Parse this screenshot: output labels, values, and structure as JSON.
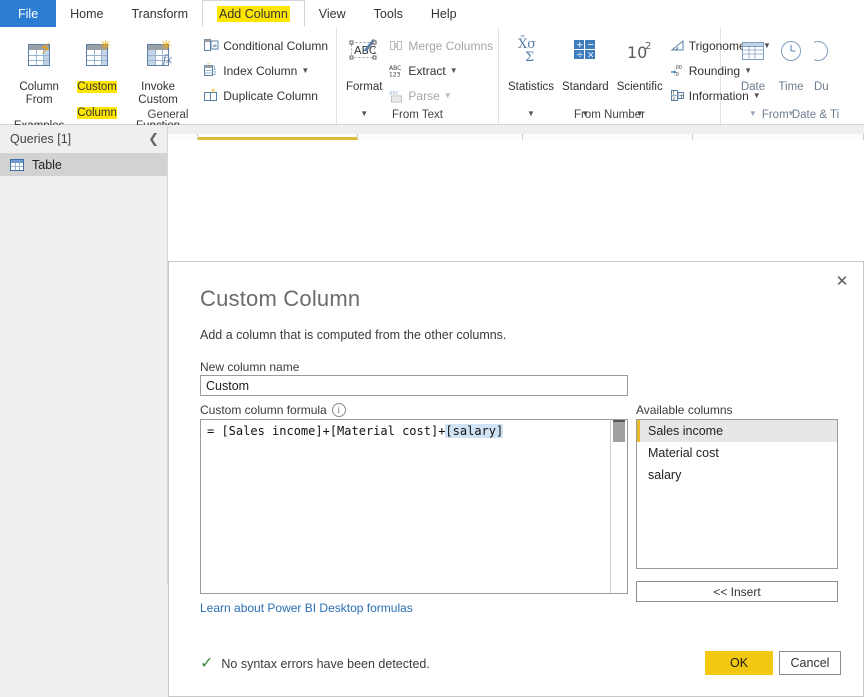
{
  "ribbon": {
    "tabs": [
      {
        "label": "File",
        "state": "file"
      },
      {
        "label": "Home",
        "state": "normal"
      },
      {
        "label": "Transform",
        "state": "normal"
      },
      {
        "label": "Add Column",
        "state": "active-highlighted"
      },
      {
        "label": "View",
        "state": "normal"
      },
      {
        "label": "Tools",
        "state": "normal"
      },
      {
        "label": "Help",
        "state": "normal"
      }
    ],
    "groups": [
      {
        "label": "General",
        "big_buttons": [
          {
            "line1": "Column From",
            "line2": "Examples",
            "has_caret": true,
            "icon": "table-bolt-icon",
            "highlighted": false
          },
          {
            "line1": "Custom",
            "line2": "Column",
            "has_caret": false,
            "icon": "table-star-icon",
            "highlighted": true
          },
          {
            "line1": "Invoke Custom",
            "line2": "Function",
            "has_caret": false,
            "icon": "table-fx-icon",
            "highlighted": false
          }
        ],
        "small_buttons": [
          {
            "label": "Conditional Column",
            "icon": "conditional-column-icon",
            "caret": false,
            "disabled": false
          },
          {
            "label": "Index Column",
            "icon": "index-column-icon",
            "caret": true,
            "disabled": false
          },
          {
            "label": "Duplicate Column",
            "icon": "duplicate-column-icon",
            "caret": false,
            "disabled": false
          }
        ]
      },
      {
        "label": "From Text",
        "big_buttons": [
          {
            "line1": "Format",
            "line2": "",
            "has_caret": true,
            "icon": "abc-format-icon",
            "highlighted": false
          }
        ],
        "small_buttons": [
          {
            "label": "Merge Columns",
            "icon": "merge-columns-icon",
            "caret": false,
            "disabled": true
          },
          {
            "label": "Extract",
            "icon": "abc123-extract-icon",
            "caret": true,
            "disabled": false
          },
          {
            "label": "Parse",
            "icon": "abc-parse-icon",
            "caret": true,
            "disabled": true
          }
        ]
      },
      {
        "label": "From Number",
        "big_buttons": [
          {
            "line1": "Statistics",
            "line2": "",
            "has_caret": true,
            "icon": "sigma-statistics-icon",
            "highlighted": false
          },
          {
            "line1": "Standard",
            "line2": "",
            "has_caret": true,
            "icon": "standard-math-icon",
            "highlighted": false
          },
          {
            "line1": "Scientific",
            "line2": "",
            "has_caret": true,
            "icon": "scientific-icon",
            "highlighted": false
          }
        ],
        "small_buttons": [
          {
            "label": "Trigonometry",
            "icon": "trigonometry-icon",
            "caret": true,
            "disabled": false
          },
          {
            "label": "Rounding",
            "icon": "rounding-icon",
            "caret": true,
            "disabled": false
          },
          {
            "label": "Information",
            "icon": "information-icon",
            "caret": true,
            "disabled": false
          }
        ]
      },
      {
        "label": "From Date & Ti",
        "big_buttons": [
          {
            "line1": "Date",
            "line2": "",
            "has_caret": true,
            "icon": "calendar-icon",
            "highlighted": false
          },
          {
            "line1": "Time",
            "line2": "",
            "has_caret": true,
            "icon": "clock-icon",
            "highlighted": false
          },
          {
            "line1": "Du",
            "line2": "",
            "has_caret": false,
            "icon": "duration-icon",
            "highlighted": false
          }
        ],
        "small_buttons": []
      }
    ]
  },
  "queries": {
    "title": "Queries [1]",
    "collapse_icon": "chevron-left-icon",
    "items": [
      {
        "label": "Table",
        "icon": "table-icon",
        "selected": true
      }
    ]
  },
  "dialog": {
    "title": "Custom Column",
    "subtitle": "Add a column that is computed from the other columns.",
    "close_label": "✕",
    "new_column_name_label": "New column name",
    "new_column_name_value": "Custom",
    "formula_label": "Custom column formula",
    "formula_info_icon": "info-icon",
    "formula_prefix": "= [Sales income]+[Material cost]+",
    "formula_selected": "[salary]",
    "learn_link": "Learn about Power BI Desktop formulas",
    "status_icon": "checkmark-icon",
    "status_text": "No syntax errors have been detected.",
    "available_columns_label": "Available columns",
    "available_columns": [
      {
        "label": "Sales income",
        "selected": true
      },
      {
        "label": "Material cost",
        "selected": false
      },
      {
        "label": "salary",
        "selected": false
      }
    ],
    "insert_label": "<< Insert",
    "ok_label": "OK",
    "cancel_label": "Cancel"
  },
  "colors": {
    "file_tab_blue": "#2b7cd3",
    "highlight_yellow": "#ffe600",
    "ok_button_yellow": "#f2c811",
    "selected_column_accent": "#e8b929",
    "link_blue": "#2a6fb5",
    "success_green": "#3c8a3c",
    "formula_selection_blue": "#cfe3f5"
  }
}
